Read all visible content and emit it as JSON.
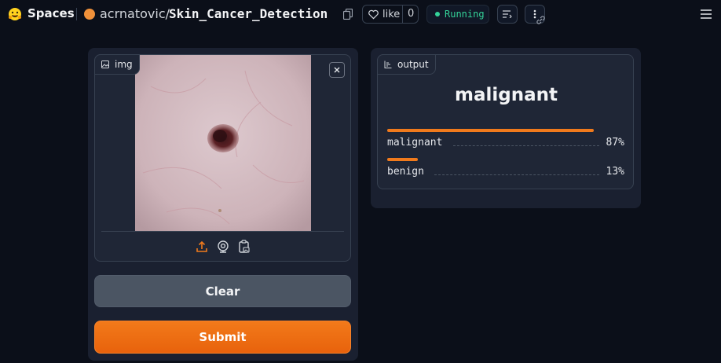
{
  "header": {
    "brand": "Spaces",
    "owner": "acrnatovic/",
    "repo": "Skin_Cancer_Detection",
    "like_label": "like",
    "like_count": "0",
    "status": "Running"
  },
  "input": {
    "label": "img"
  },
  "buttons": {
    "clear": "Clear",
    "submit": "Submit"
  },
  "output": {
    "label": "output",
    "prediction": "malignant",
    "confidences": [
      {
        "label": "malignant",
        "percent": "87%",
        "value": 0.87
      },
      {
        "label": "benign",
        "percent": "13%",
        "value": 0.13
      }
    ]
  },
  "colors": {
    "accent": "#f07a1c",
    "status": "#34d399",
    "background": "#0b0f19"
  }
}
